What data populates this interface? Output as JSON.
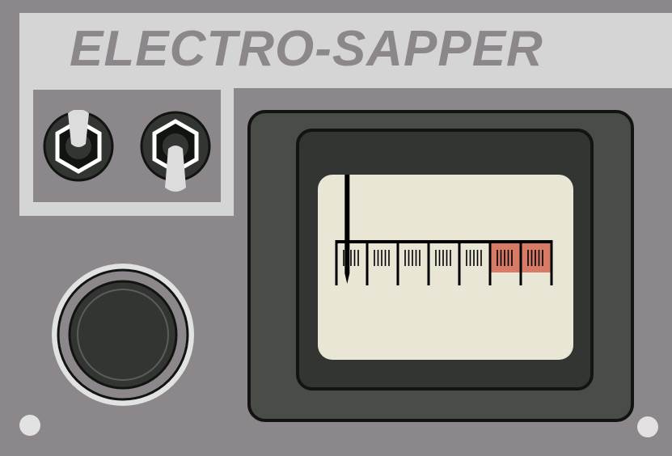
{
  "panel": {
    "title": "ELECTRO-SAPPER",
    "colors": {
      "panel": "#8b878b",
      "plate": "#d5d5d5",
      "housing": "#4a4c47",
      "bezel": "#323532",
      "face": "#e9e6d5",
      "danger_zone": "#d77a66",
      "needle": "#000000"
    }
  },
  "switches": [
    {
      "name": "left-toggle-switch",
      "state": "up"
    },
    {
      "name": "right-toggle-switch",
      "state": "down"
    }
  ],
  "meter": {
    "segments": 7,
    "minor_ticks_per_segment": 5,
    "danger_segments": 2,
    "needle_segment_position": 0.35
  },
  "jack": {
    "icon": "round-jack-socket"
  },
  "screws": 2
}
